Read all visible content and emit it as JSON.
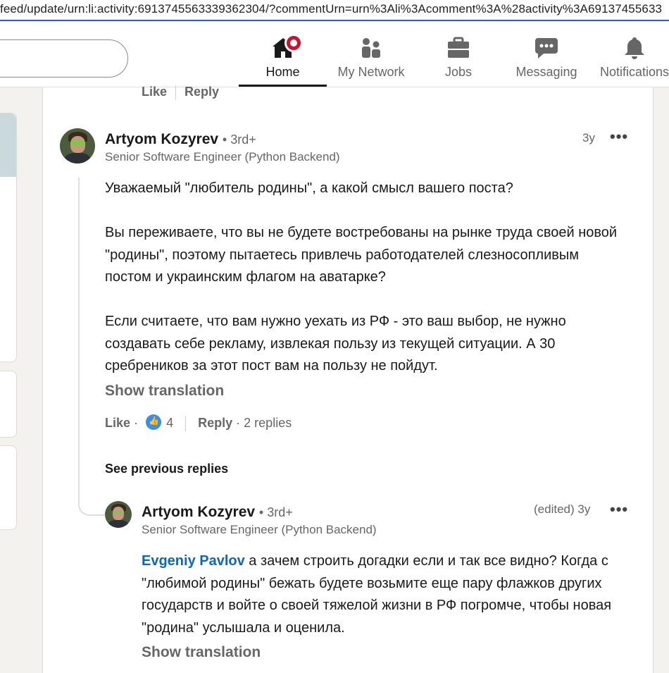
{
  "browser": {
    "url": "feed/update/urn:li:activity:6913745563339362304/?commentUrn=urn%3Ali%3Acomment%3A%28activity%3A69137455633"
  },
  "nav": {
    "items": [
      {
        "label": "Home",
        "icon": "home-icon",
        "active": true
      },
      {
        "label": "My Network",
        "icon": "people-icon"
      },
      {
        "label": "Jobs",
        "icon": "briefcase-icon"
      },
      {
        "label": "Messaging",
        "icon": "chat-icon"
      },
      {
        "label": "Notifications",
        "icon": "bell-icon"
      }
    ]
  },
  "previous_comment": {
    "like_label": "Like",
    "reply_label": "Reply"
  },
  "comment": {
    "author": "Artyom Kozyrev",
    "degree": "• 3rd+",
    "headline": "Senior Software Engineer (Python Backend)",
    "time": "3y",
    "menu": "•••",
    "paragraphs": [
      "Уважаемый \"любитель родины\", а какой смысл вашего поста?",
      "Вы переживаете, что вы не будете востребованы на рынке труда своей новой \"родины\", поэтому пытаетесь привлечь работодателей слезносопливым постом и украинским флагом на аватарке?",
      "Если считаете, что вам нужно уехать из РФ - это ваш выбор, не нужно создавать себе рекламу, извлекая пользу из текущей ситуации. А 30 сребреников за этот пост вам на пользу не пойдут."
    ],
    "show_translation": "Show translation",
    "like_label": "Like",
    "dot": "·",
    "reactions": "4",
    "reply_label": "Reply",
    "replies": "· 2 replies"
  },
  "see_previous_replies": "See previous replies",
  "reply": {
    "author": "Artyom Kozyrev",
    "degree": "• 3rd+",
    "headline": "Senior Software Engineer (Python Backend)",
    "time": "(edited) 3y",
    "menu": "•••",
    "mention": "Evgeniy Pavlov",
    "text": " а зачем строить догадки если и так все видно? Когда с \"любимой родины\" бежать будете возьмите еще пару флажков других государств и войте о своей тяжелой жизни в РФ погромче, чтобы новая \"родина\" услышала и оценила.",
    "show_translation": "Show translation"
  }
}
